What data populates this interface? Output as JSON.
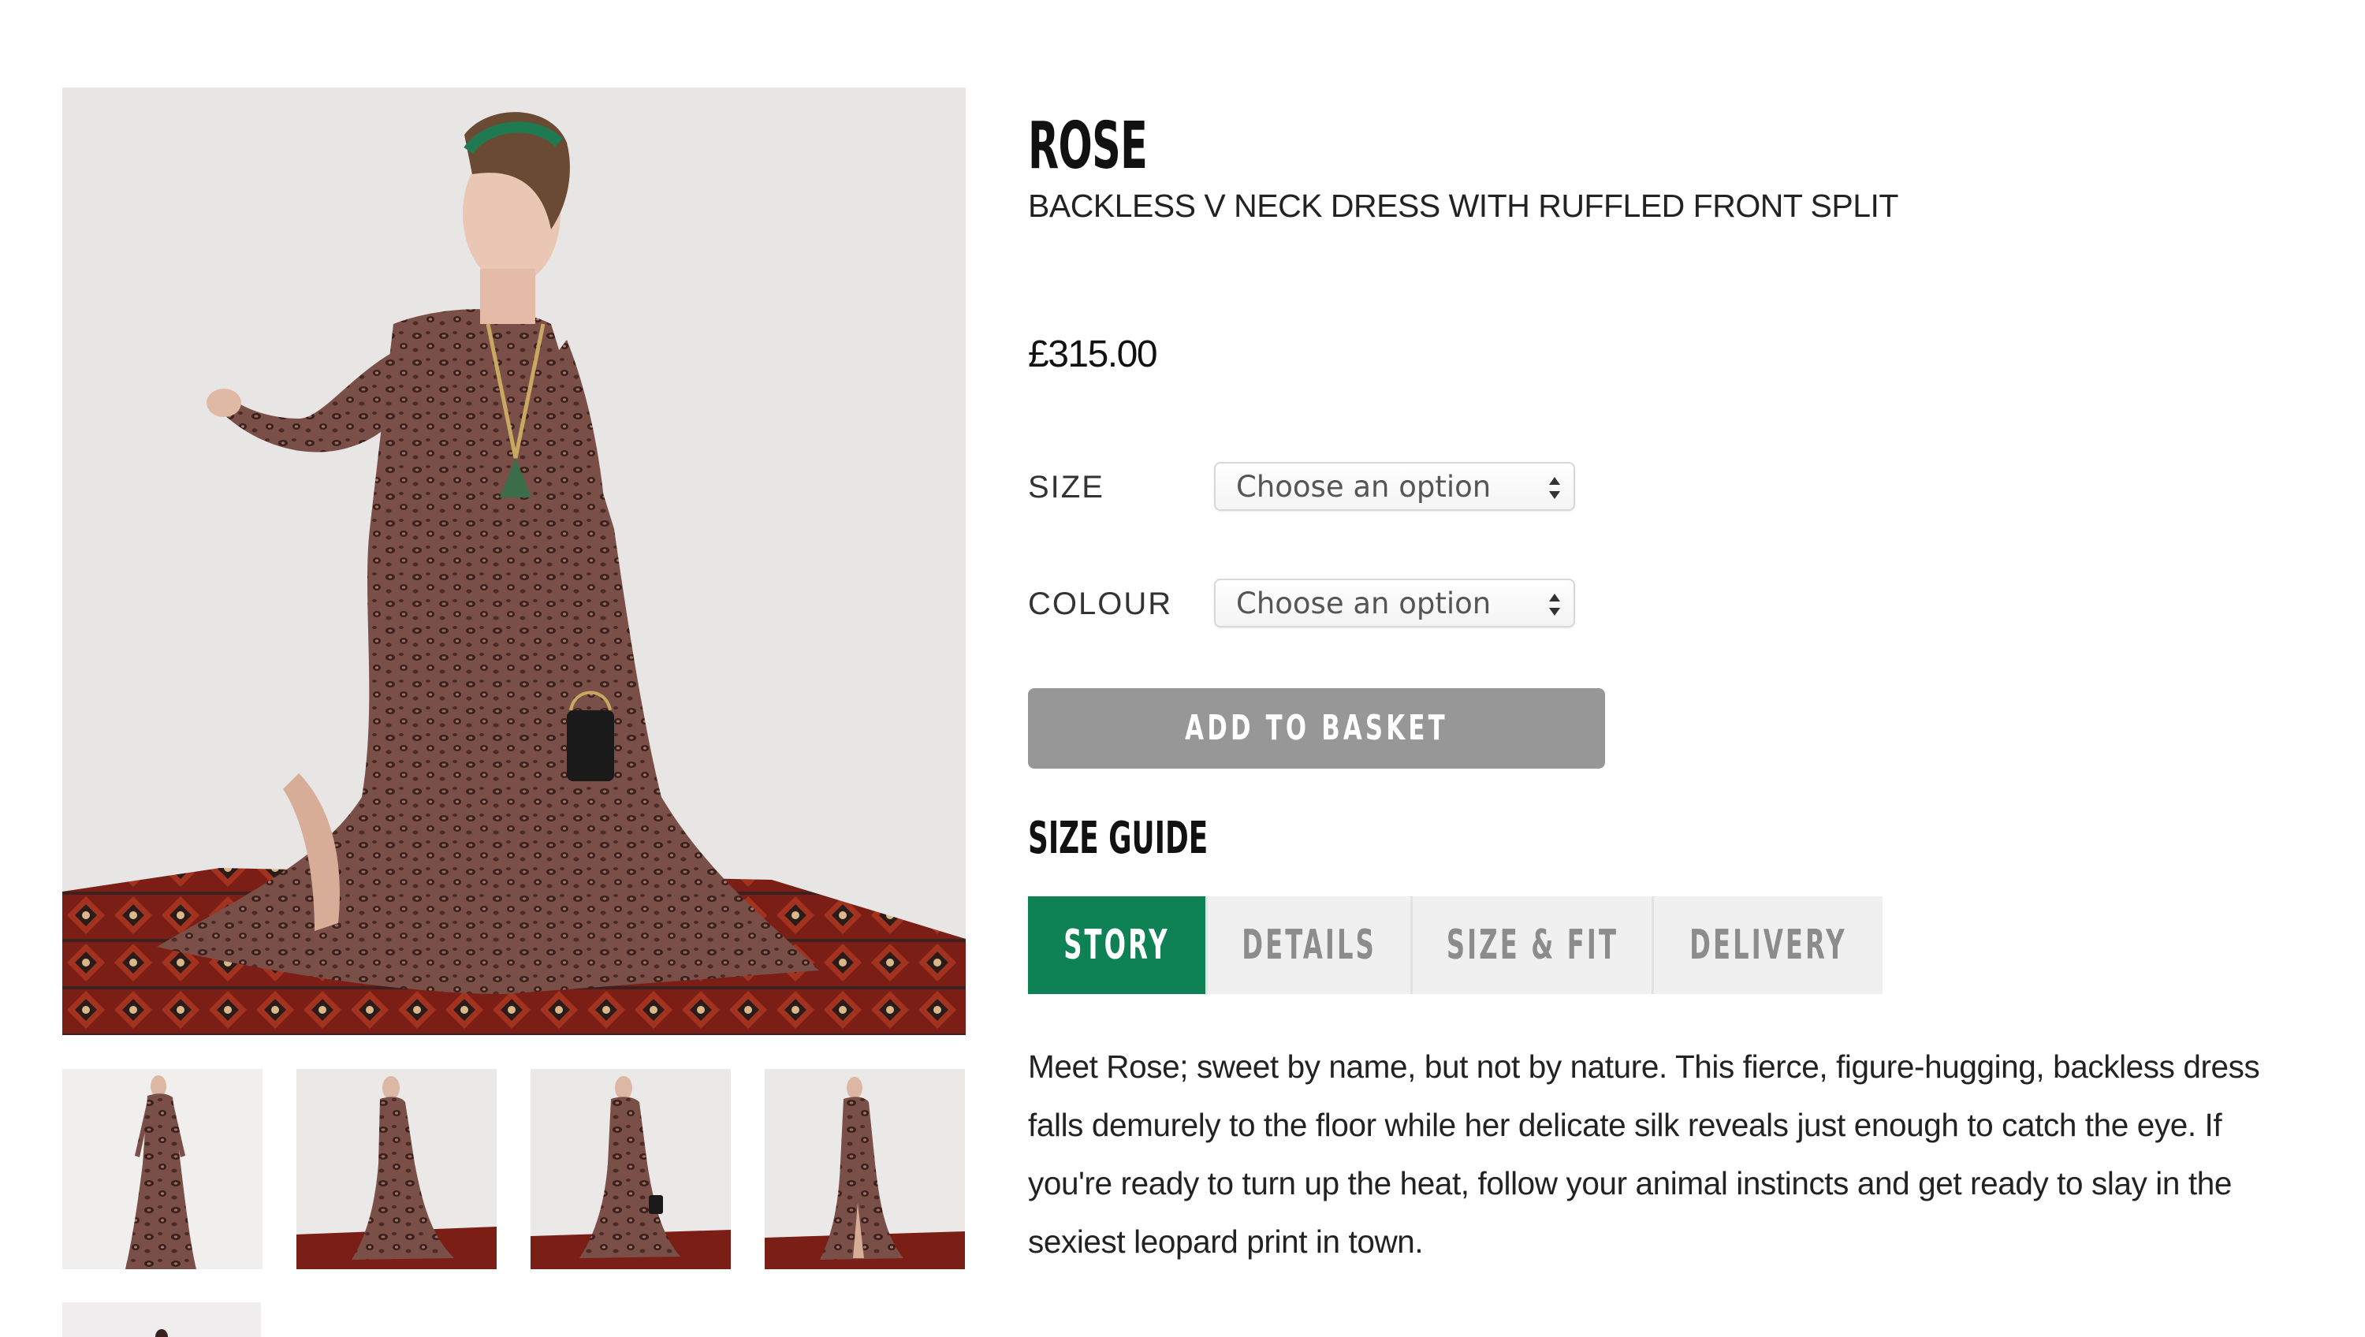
{
  "product": {
    "title": "ROSE",
    "subtitle": "BACKLESS V NECK DRESS WITH RUFFLED FRONT SPLIT",
    "price": "£315.00"
  },
  "options": [
    {
      "label": "SIZE",
      "placeholder": "Choose an option"
    },
    {
      "label": "COLOUR",
      "placeholder": "Choose an option"
    }
  ],
  "actions": {
    "add_to_basket": "ADD TO BASKET",
    "size_guide": "SIZE GUIDE"
  },
  "tabs": [
    {
      "label": "STORY",
      "active": true
    },
    {
      "label": "DETAILS",
      "active": false
    },
    {
      "label": "SIZE & FIT",
      "active": false
    },
    {
      "label": "DELIVERY",
      "active": false
    }
  ],
  "description": "Meet Rose; sweet by name, but not by nature. This fierce, figure-hugging, backless dress falls demurely to the floor while her delicate silk reveals just enough to catch the eye. If you're ready to turn up the heat, follow your animal instincts and get ready to slay in the sexiest leopard print in town.",
  "colors": {
    "accent_green": "#0f8255",
    "button_grey": "#979797",
    "tab_inactive_bg": "#f0f0f0"
  },
  "images": {
    "main": "model-photo",
    "thumbnails": [
      "front-view",
      "side-view",
      "front-bag-view",
      "side-split-view"
    ]
  }
}
